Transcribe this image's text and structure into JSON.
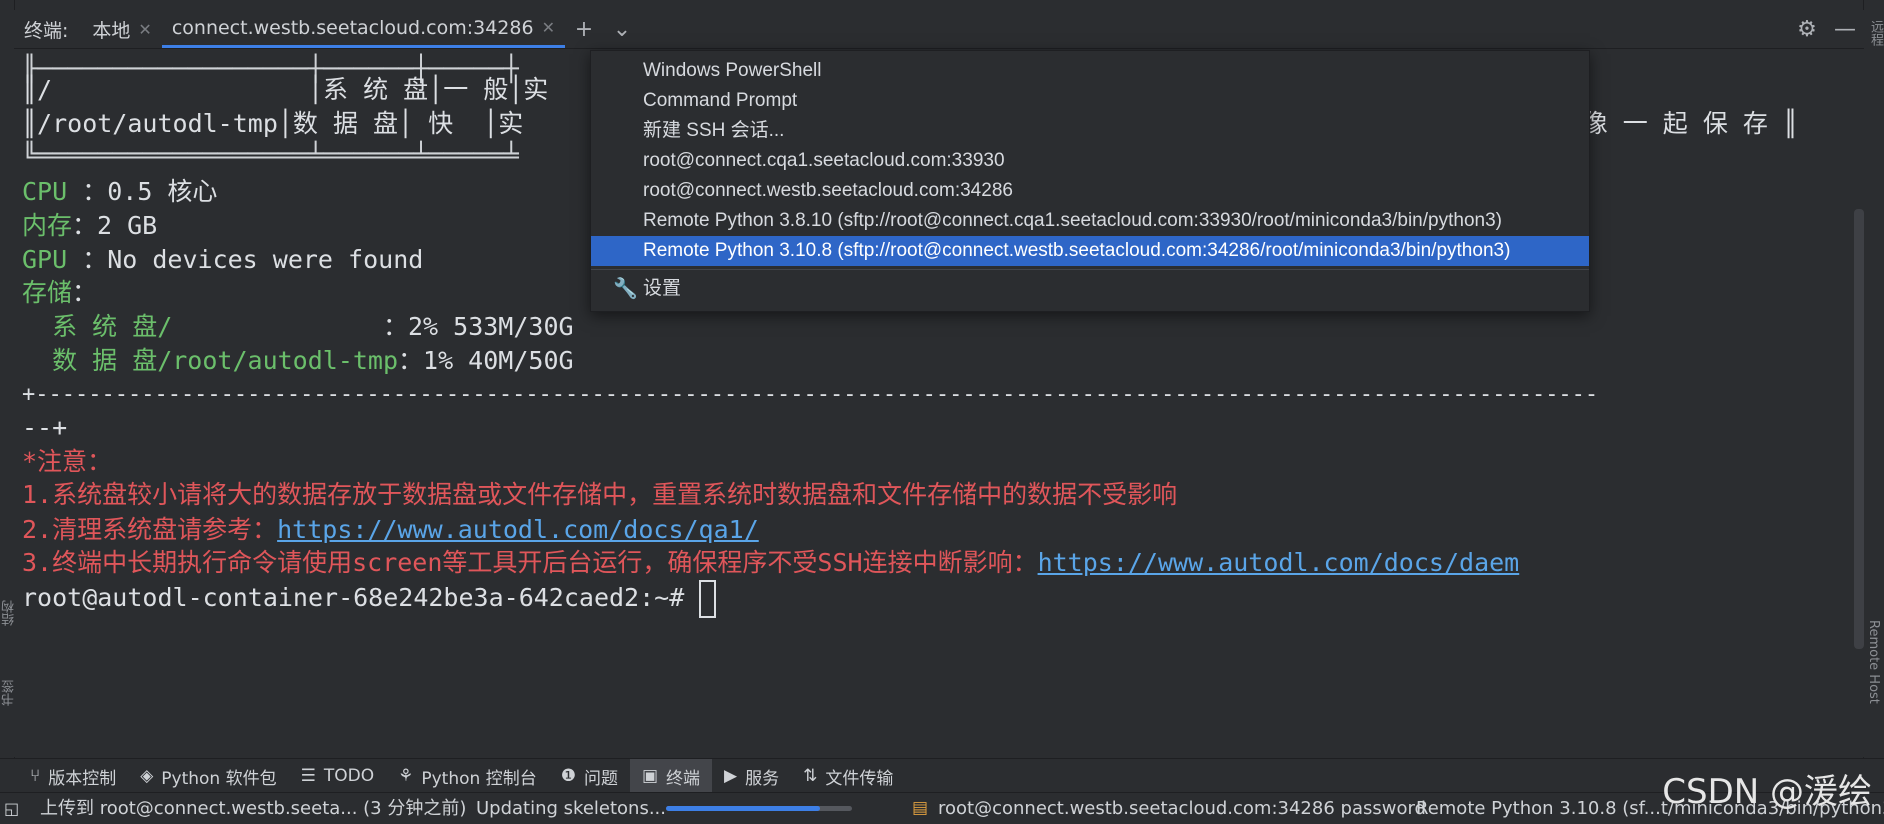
{
  "tabbar": {
    "title": "终端:",
    "tabs": [
      {
        "label": "本地"
      },
      {
        "label": "connect.westb.seetacloud.com:34286"
      }
    ]
  },
  "terminal": {
    "box_top": "╟──────────────────┼──────┼─────┼",
    "box_row1": {
      "path": "║/",
      "pad": "                 ",
      "col2": "│系 统 盘│一 般│实"
    },
    "box_row2": {
      "path": "║/root/autodl-tmp",
      "col2": "│数 据 盘│ 快  │实",
      "tail": "像 一 起 保 存 ║"
    },
    "box_bottom": "╚══════════════════╧══════╧═════╧",
    "cpu": {
      "label": "CPU ",
      "value": "：0.5 核心"
    },
    "mem": {
      "label": "内存",
      "value": "：2 GB"
    },
    "gpu": {
      "label": "GPU ",
      "value": "：No devices were found"
    },
    "storage": {
      "label": "存储",
      "value": "："
    },
    "sysdisk": {
      "label": "  系 统 盘/              ",
      "value": "：2% 533M/30G"
    },
    "datadisk": {
      "label": "  数 据 盘/root/autodl-tmp",
      "value": "：1% 40M/50G"
    },
    "divider": "+----------------------------------------------------------------------------------------------------------------------",
    "divider_tail": "--+",
    "notice": "*注意：",
    "note1": "1.系统盘较小请将大的数据存放于数据盘或文件存储中，重置系统时数据盘和文件存储中的数据不受影响",
    "note2_prefix": "2.清理系统盘请参考：",
    "note2_link": "https://www.autodl.com/docs/qa1/",
    "note3_prefix": "3.终端中长期执行命令请使用screen等工具开后台运行，确保程序不受SSH连接中断影响：",
    "note3_link": "https://www.autodl.com/docs/daem",
    "prompt": "root@autodl-container-68e242be3a-642caed2:~# "
  },
  "dropdown": {
    "items": [
      "Windows PowerShell",
      "Command Prompt",
      "新建 SSH 会话...",
      "root@connect.cqa1.seetacloud.com:33930",
      "root@connect.westb.seetacloud.com:34286",
      "Remote Python 3.8.10 (sftp://root@connect.cqa1.seetacloud.com:33930/root/miniconda3/bin/python3)",
      "Remote Python 3.10.8 (sftp://root@connect.westb.seetacloud.com:34286/root/miniconda3/bin/python3)"
    ],
    "selected_index": 6,
    "settings_label": "设置"
  },
  "toolwindows": [
    {
      "label": "版本控制",
      "icon": "branch-icon"
    },
    {
      "label": "Python 软件包",
      "icon": "layers-icon"
    },
    {
      "label": "TODO",
      "icon": "list-icon"
    },
    {
      "label": "Python 控制台",
      "icon": "python-icon"
    },
    {
      "label": "问题",
      "icon": "alert-icon"
    },
    {
      "label": "终端",
      "icon": "terminal-icon",
      "active": true
    },
    {
      "label": "服务",
      "icon": "play-icon"
    },
    {
      "label": "文件传输",
      "icon": "transfer-icon"
    }
  ],
  "statusbar": {
    "upload": "上传到 root@connect.westb.seeta... (3 分钟之前)",
    "task": "Updating skeletons...",
    "progress": 0.83,
    "connection": "root@connect.westb.seetacloud.com:34286 password",
    "interpreter": "Remote Python 3.10.8 (sf...t/miniconda3/bin/python3)"
  },
  "watermark": "CSDN @湲绘",
  "side": {
    "right_top": "远程",
    "right_bottom": "Remote Host",
    "left_bottom1": "结构",
    "left_bottom2": "书签"
  },
  "colors": {
    "accent": "#3d7fe6",
    "green": "#6bbf6b",
    "red": "#e0565a",
    "link": "#5aa5e8",
    "selection": "#2e66c7"
  }
}
